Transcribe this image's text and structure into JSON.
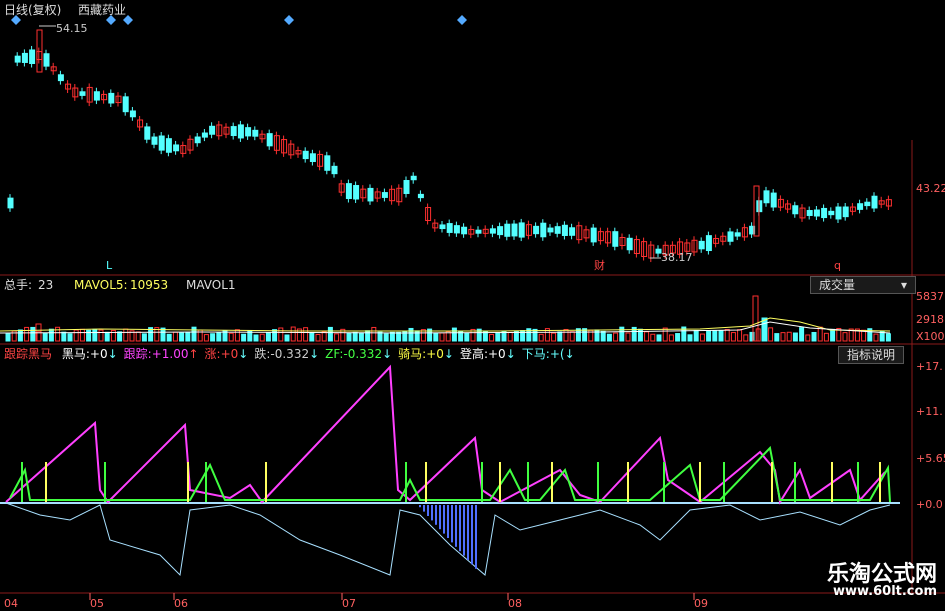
{
  "header": {
    "period": "日线(复权)",
    "stock_name": "西藏药业",
    "high_marker": "54.15",
    "low_marker": "38.17",
    "markers": [
      "L",
      "财",
      "q"
    ]
  },
  "price_axis": {
    "label": "43.22"
  },
  "volume_panel": {
    "total_label": "总手:",
    "total_value": "23",
    "mavol5_label": "MAVOL5:",
    "mavol5_value": "10953",
    "mavol1_label": "MAVOL1",
    "dropdown_label": "成交量",
    "axis_labels": [
      "5837",
      "2918",
      "X100"
    ]
  },
  "indicator_panel": {
    "name": "跟踪黑马",
    "items": [
      {
        "label": "黑马:",
        "value": "+0",
        "color": "#ffffff"
      },
      {
        "label": "跟踪:",
        "value": "+1.00",
        "color": "#ff44ff"
      },
      {
        "label": "涨:",
        "value": "+0",
        "color": "#ff4444"
      },
      {
        "label": "跌:",
        "value": "-0.332",
        "color": "#cccccc"
      },
      {
        "label": "ZF:",
        "value": "-0.332",
        "color": "#44ff44"
      },
      {
        "label": "骑马:",
        "value": "+0",
        "color": "#ffff44"
      },
      {
        "label": "登高:",
        "value": "+0",
        "color": "#ffffff"
      },
      {
        "label": "下马:",
        "value": "+(",
        "color": "#66ffff"
      }
    ],
    "help_button": "指标说明",
    "axis_labels": [
      "+17.",
      "+11.",
      "+5.65",
      "+0.0"
    ]
  },
  "date_axis": [
    "04",
    "05",
    "06",
    "07",
    "08",
    "09"
  ],
  "watermark": {
    "cn": "乐淘公式网",
    "url": "www.60lt.com"
  },
  "colors": {
    "up": "#ff3030",
    "down": "#54ffff",
    "magenta": "#ff40ff",
    "green": "#40ff40",
    "yellow": "#ffff60",
    "blue": "#5070ff",
    "lightblue": "#a8e0ff"
  }
}
